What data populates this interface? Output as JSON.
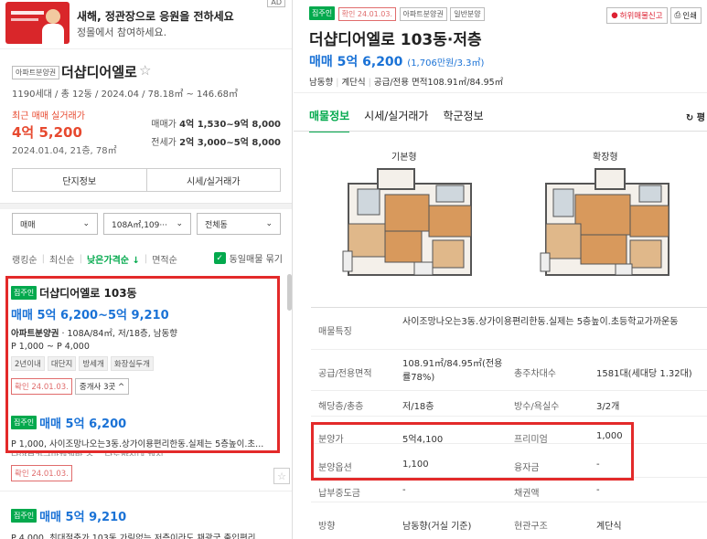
{
  "ad": {
    "badge": "AD",
    "title": "새해, 정관장으로 응원을 전하세요",
    "subtitle": "정몰에서 참여하세요."
  },
  "complex": {
    "tag": "아파트분양권",
    "name": "더샵디어엘로",
    "meta": "1190세대 / 총 12동 / 2024.04 / 78.18㎡ ~ 146.68㎡",
    "recent_label": "최근 매매 실거래가",
    "recent_price": "4억 5,200",
    "recent_date": "2024.01.04, 21층, 78㎡",
    "sale_label": "매매가",
    "sale_range": "4억 1,530~9억 8,000",
    "rent_label": "전세가",
    "rent_range": "2억 3,000~5억 8,000",
    "btn_info": "단지정보",
    "btn_price": "시세/실거래가"
  },
  "filters": {
    "type": "매매",
    "area": "108A㎡,109···",
    "dong": "전체동"
  },
  "sorts": {
    "ranking": "랭킹순",
    "latest": "최신순",
    "low_price": "낮은가격순 ↓",
    "area": "면적순",
    "same_listing": "동일매물 묶기"
  },
  "listings": [
    {
      "tag": "집주인",
      "title": "더샵디어엘로 103동",
      "price": "매매 5억 6,200~5억 9,210",
      "spec_a": "아파트분양권",
      "spec_b": " · 108A/84㎡, 저/18층, 남동향",
      "premium": "P 1,000 ~ P 4,000",
      "chips": [
        "2년이내",
        "대단지",
        "방세개",
        "화장실두개"
      ],
      "confirm": "확인 24.01.03.",
      "agents": "중개사 3곳 ^"
    },
    {
      "tag": "집주인",
      "price": "매매 5억 6,200",
      "desc": "P 1,000, 사이조망나오는3동.상가이용편리한동.실제는 5층높이.초...",
      "desc2": "남양부가국망재개발 주... 남동향실내 재질",
      "confirm": "확인 24.01.03."
    },
    {
      "tag": "집주인",
      "price": "매매 5억 9,210",
      "desc": "P 4,000, 최대절충가,103동 가림없는 저층이라도 채광굿,출입편리"
    }
  ],
  "detail": {
    "tag": "집주인",
    "confirm": "확인 24.01.03.",
    "tag2": "아파트분양권",
    "tag3": "일반분양",
    "report": "허위매물신고",
    "print": "인쇄",
    "title": "더샵디어엘로 103동·저층",
    "price": "매매 5억 6,200",
    "price_unit": "(1,706만원/3.3㎡)",
    "dir": "남동향",
    "stair": "계단식",
    "area": "공급/전용 면적108.91㎡/84.95㎡",
    "tabs": [
      "매물정보",
      "시세/실거래가",
      "학군정보"
    ],
    "refresh": "평",
    "fp_basic": "기본형",
    "fp_ext": "확장형",
    "rows": [
      {
        "k": "매물특징",
        "v": "사이조망나오는3동.상가이용편리한동.실제는 5층높이.초등학교가까운동"
      },
      {
        "k": "공급/전용면적",
        "v": "108.91㎡/84.95㎡(전용률78%)",
        "k2": "총주차대수",
        "v2": "1581대(세대당 1.32대)"
      },
      {
        "k": "해당층/총층",
        "v": "저/18층",
        "k2": "방수/욕실수",
        "v2": "3/2개"
      },
      {
        "k": "분양가",
        "v": "5억4,100",
        "k2": "프리미엄",
        "v2": "1,000"
      },
      {
        "k": "분양옵션",
        "v": "1,100",
        "k2": "융자금",
        "v2": "-"
      },
      {
        "k": "납부중도금",
        "v": "-",
        "k2": "채권액",
        "v2": "-"
      },
      {
        "k": "방향",
        "v": "남동향(거실 기준)",
        "k2": "현관구조",
        "v2": "계단식"
      }
    ]
  }
}
